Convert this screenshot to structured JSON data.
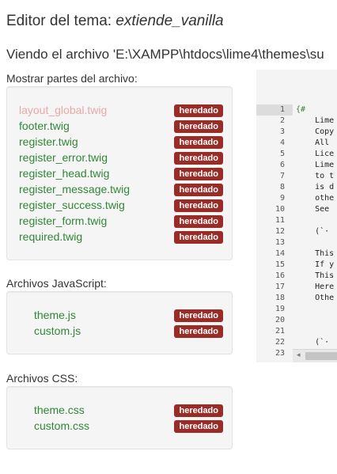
{
  "header": {
    "title_prefix": "Editor del tema: ",
    "theme_name": "extiende_vanilla",
    "subtitle": "Viendo el archivo 'E:\\XAMPP\\htdocs\\lime4\\themes\\su"
  },
  "layout_section": {
    "label": "Mostrar partes del archivo:",
    "files": [
      {
        "name": "layout_global.twig",
        "badge": "heredado",
        "current": true
      },
      {
        "name": "footer.twig",
        "badge": "heredado"
      },
      {
        "name": "register.twig",
        "badge": "heredado"
      },
      {
        "name": "register_error.twig",
        "badge": "heredado"
      },
      {
        "name": "register_head.twig",
        "badge": "heredado"
      },
      {
        "name": "register_message.twig",
        "badge": "heredado"
      },
      {
        "name": "register_success.twig",
        "badge": "heredado"
      },
      {
        "name": "register_form.twig",
        "badge": "heredado"
      },
      {
        "name": "required.twig",
        "badge": "heredado"
      }
    ]
  },
  "js_section": {
    "label": "Archivos JavaScript:",
    "files": [
      {
        "name": "theme.js",
        "badge": "heredado"
      },
      {
        "name": "custom.js",
        "badge": "heredado"
      }
    ]
  },
  "css_section": {
    "label": "Archivos CSS:",
    "files": [
      {
        "name": "theme.css",
        "badge": "heredado"
      },
      {
        "name": "custom.css",
        "badge": "heredado"
      }
    ]
  },
  "editor": {
    "lines": [
      {
        "n": "1",
        "text": "{#"
      },
      {
        "n": "2",
        "text": "    Lime"
      },
      {
        "n": "3",
        "text": "    Copy"
      },
      {
        "n": "4",
        "text": "    All"
      },
      {
        "n": "5",
        "text": "    Lice"
      },
      {
        "n": "6",
        "text": "    Lime"
      },
      {
        "n": "7",
        "text": "    to t"
      },
      {
        "n": "8",
        "text": "    is d"
      },
      {
        "n": "9",
        "text": "    othe"
      },
      {
        "n": "10",
        "text": "    See"
      },
      {
        "n": "11",
        "text": ""
      },
      {
        "n": "12",
        "text": "    (`·"
      },
      {
        "n": "13",
        "text": ""
      },
      {
        "n": "14",
        "text": "    This"
      },
      {
        "n": "15",
        "text": "    If y"
      },
      {
        "n": "16",
        "text": "    This"
      },
      {
        "n": "17",
        "text": "    Here"
      },
      {
        "n": "18",
        "text": "    Othe"
      },
      {
        "n": "19",
        "text": ""
      },
      {
        "n": "20",
        "text": ""
      },
      {
        "n": "21",
        "text": ""
      },
      {
        "n": "22",
        "text": "    (`·"
      },
      {
        "n": "23",
        "text": ""
      }
    ],
    "scroll_left_icon": "◂"
  }
}
